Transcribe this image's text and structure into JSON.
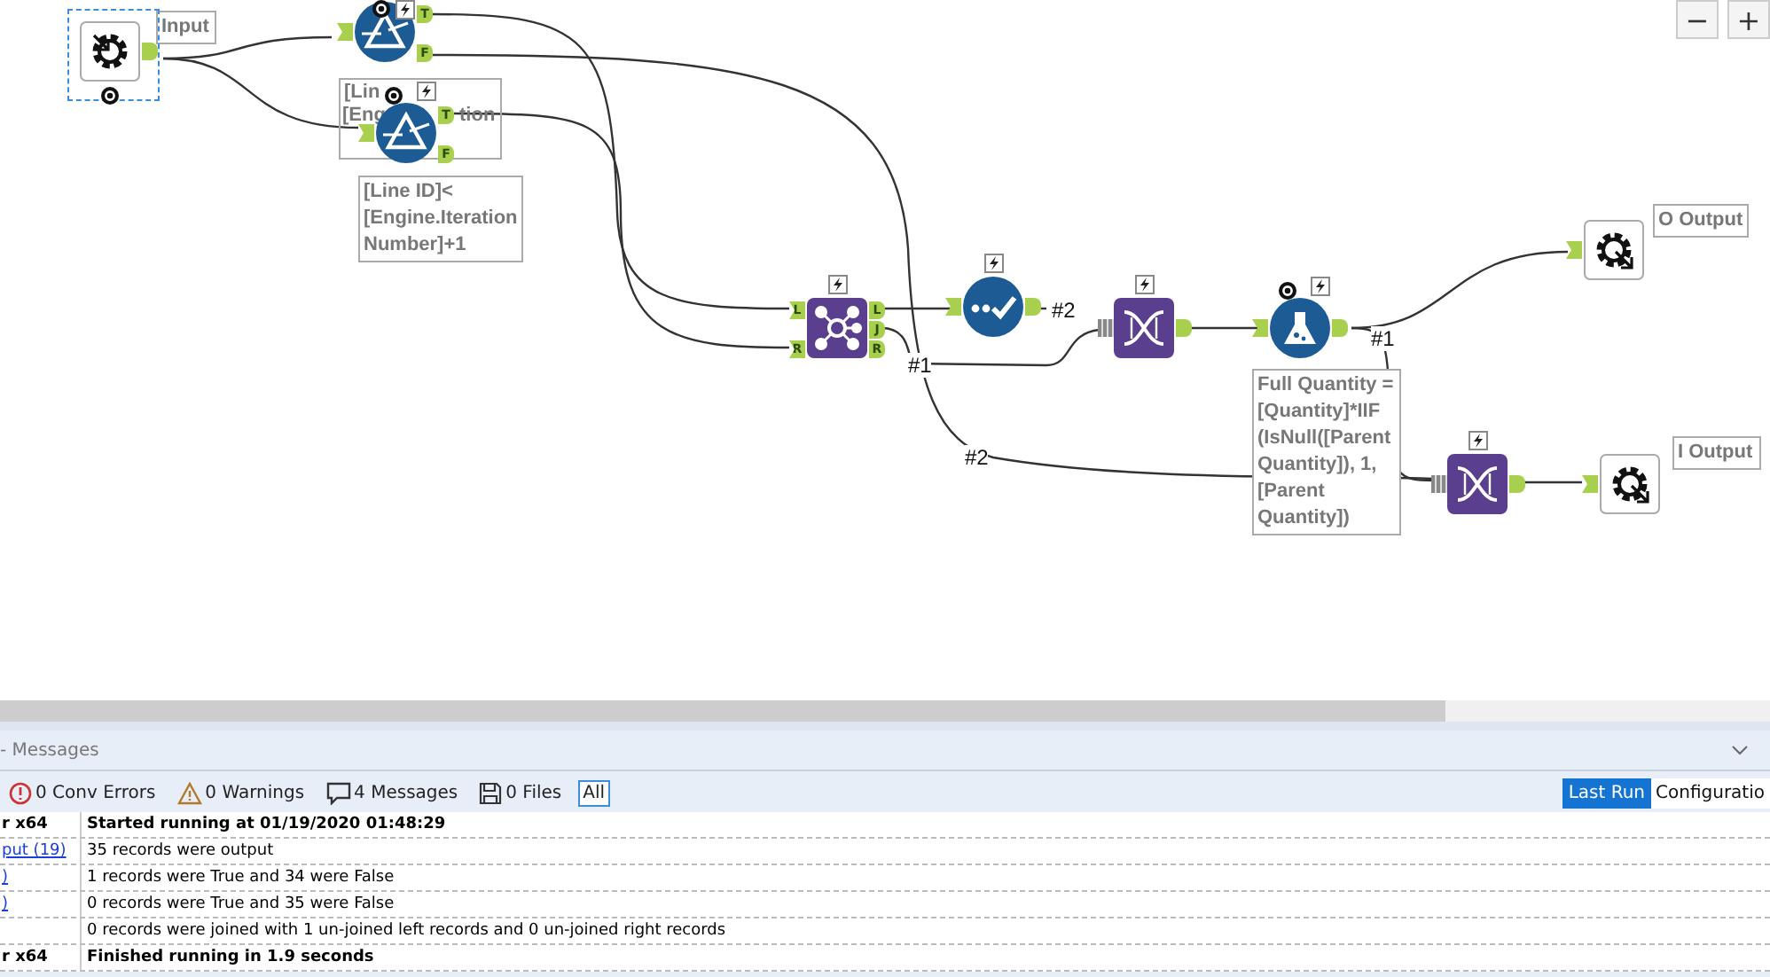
{
  "canvas": {
    "zoom_buttons": [
      "−",
      "+"
    ],
    "nodes": [
      {
        "kind": "input",
        "selected": true,
        "lightning": false,
        "tag": true
      },
      {
        "kind": "filter",
        "selected": false,
        "lightning": true,
        "tag": true,
        "outputs": [
          "T",
          "F"
        ]
      },
      {
        "kind": "filter",
        "selected": false,
        "lightning": true,
        "tag": true,
        "outputs": [
          "T",
          "F"
        ]
      },
      {
        "kind": "join",
        "selected": false,
        "lightning": true,
        "tag": false,
        "inputs": [
          "L",
          "R"
        ],
        "outputs": [
          "L",
          "J",
          "R"
        ]
      },
      {
        "kind": "check",
        "selected": false,
        "lightning": true,
        "tag": false
      },
      {
        "kind": "union",
        "selected": false,
        "lightning": true,
        "tag": false
      },
      {
        "kind": "formula",
        "selected": false,
        "lightning": true,
        "tag": true
      },
      {
        "kind": "output",
        "selected": false,
        "lightning": false,
        "tag": false
      },
      {
        "kind": "union",
        "selected": false,
        "lightning": true,
        "tag": false
      },
      {
        "kind": "output",
        "selected": false,
        "lightning": false,
        "tag": false
      }
    ],
    "annotations": [
      {
        "text": "Input"
      },
      {
        "fragments": [
          "[Lin",
          "[Eng",
          "tion"
        ]
      },
      {
        "text": "[Line ID]<\n[Engine.Iteration\nNumber]+1"
      },
      {
        "text": "Full Quantity =\n[Quantity]*IIF\n(IsNull([Parent\nQuantity]), 1,\n[Parent\nQuantity])"
      },
      {
        "text": "O Output"
      },
      {
        "text": "I Output"
      }
    ],
    "wire_labels": [
      "#2",
      "#1",
      "#2",
      "#1"
    ]
  },
  "messages": {
    "title": "- Messages",
    "filters": [
      {
        "kind": "error",
        "label": "0 Conv Errors",
        "selected": false
      },
      {
        "kind": "warning",
        "label": "0 Warnings",
        "selected": false
      },
      {
        "kind": "message",
        "label": "4 Messages",
        "selected": false
      },
      {
        "kind": "file",
        "label": "0 Files",
        "selected": false
      },
      {
        "kind": "plain",
        "label": "All",
        "selected": true
      }
    ],
    "views": [
      {
        "label": "Last Run",
        "selected": true
      },
      {
        "label": "Configuratio",
        "selected": false
      }
    ],
    "rows": [
      {
        "source": "r x64",
        "kind": "bold",
        "text": "Started running at 01/19/2020 01:48:29"
      },
      {
        "source": "put (19)",
        "kind": "link",
        "text": "35 records were output"
      },
      {
        "source": ")",
        "kind": "link",
        "text": "1 records were True and 34 were False"
      },
      {
        "source": ")",
        "kind": "link",
        "text": "0 records were True and 35 were False"
      },
      {
        "kind": "link",
        "text": "0 records were joined with 1 un-joined left records and 0 un-joined right records"
      },
      {
        "source": "r x64",
        "kind": "bold",
        "text": "Finished running in 1.9 seconds"
      }
    ]
  }
}
